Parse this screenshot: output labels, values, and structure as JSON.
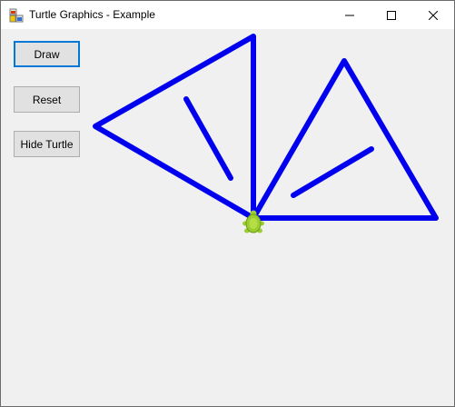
{
  "window": {
    "title": "Turtle Graphics - Example"
  },
  "titlebar_buttons": {
    "minimize_icon": "minimize-icon",
    "maximize_icon": "maximize-icon",
    "close_icon": "close-icon"
  },
  "buttons": {
    "draw_label": "Draw",
    "reset_label": "Reset",
    "hide_turtle_label": "Hide Turtle"
  },
  "colors": {
    "line": "#0000ee",
    "turtle_body": "#9acd32",
    "turtle_shell": "#6e9b12",
    "focus_border": "#0078d7"
  }
}
